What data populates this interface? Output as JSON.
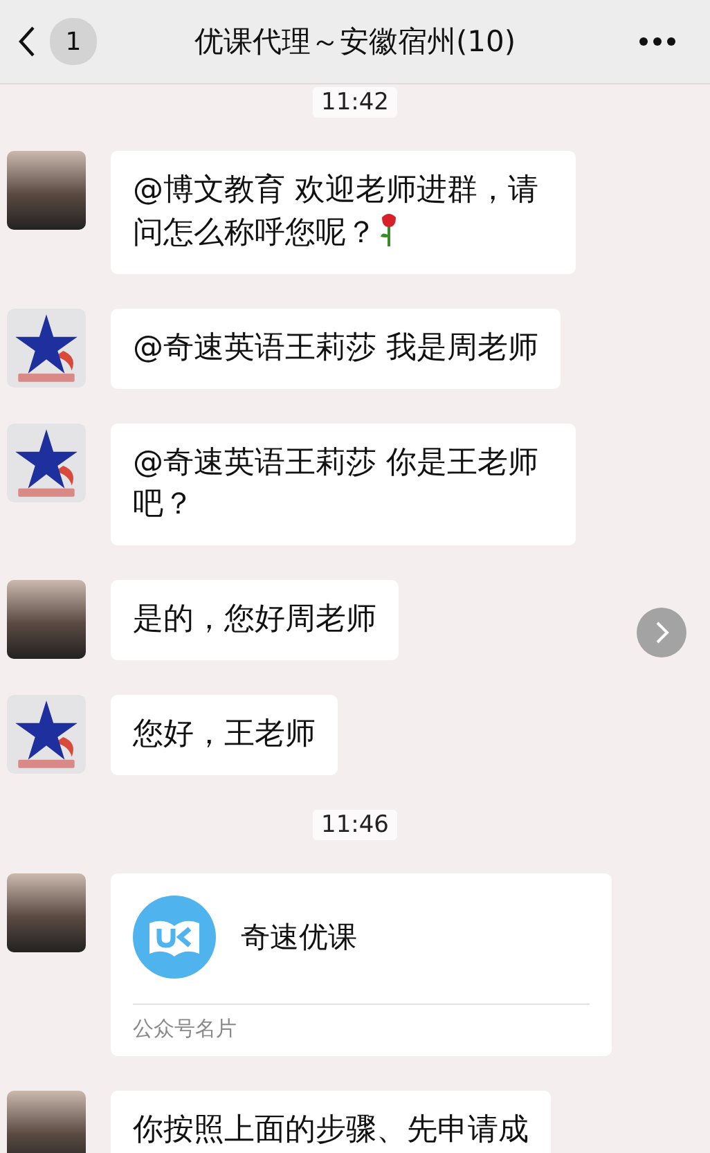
{
  "header": {
    "unread_count": "1",
    "title": "优课代理～安徽宿州(10)"
  },
  "messages": [
    {
      "kind": "time",
      "text": "11:42"
    },
    {
      "kind": "text",
      "avatar": {
        "kind": "photo"
      },
      "text": "@博文教育 欢迎老师进群，请问怎么称呼您呢？",
      "sticker": {
        "kind": "rose"
      }
    },
    {
      "kind": "text",
      "avatar": {
        "kind": "logo"
      },
      "text": "@奇速英语王莉莎 我是周老师"
    },
    {
      "kind": "text",
      "avatar": {
        "kind": "logo"
      },
      "text": "@奇速英语王莉莎 你是王老师吧？"
    },
    {
      "kind": "text",
      "avatar": {
        "kind": "photo"
      },
      "text": "是的，您好周老师"
    },
    {
      "kind": "text",
      "avatar": {
        "kind": "logo"
      },
      "text": "您好，王老师"
    },
    {
      "kind": "time",
      "text": "11:46"
    },
    {
      "kind": "card",
      "avatar": {
        "kind": "photo"
      },
      "name": "奇速优课",
      "label": "公众号名片"
    },
    {
      "kind": "text",
      "avatar": {
        "kind": "photo"
      },
      "text": "你按照上面的步骤、先申请成"
    }
  ]
}
